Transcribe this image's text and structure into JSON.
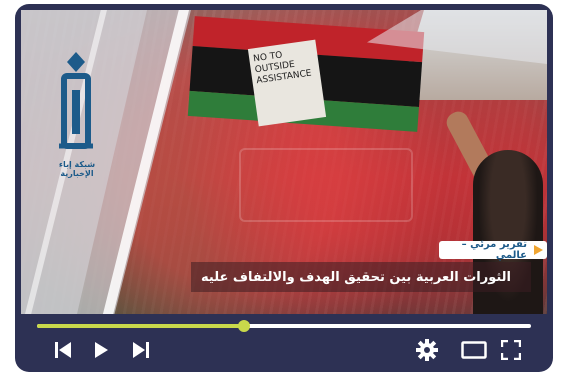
{
  "video": {
    "sign_text": "NO TO OUTSIDE ASSISTANCE",
    "tag_label": "تقرير مرئي – عالمي",
    "caption": "الثورات العربية بين تحقيق الهدف والالتفاف عليه"
  },
  "logo": {
    "name": "شبكة إباء الإخبارية"
  },
  "player": {
    "progress": 0.42,
    "colors": {
      "frame": "#2d3154",
      "progress": "#c8d84b",
      "icons": "#ffffff",
      "tag_play": "#f0a531",
      "logo": "#1d5b8a"
    },
    "icons": [
      "skip-back-icon",
      "play-icon",
      "skip-forward-icon",
      "settings-gear-icon",
      "theater-mode-icon",
      "fullscreen-icon"
    ]
  }
}
